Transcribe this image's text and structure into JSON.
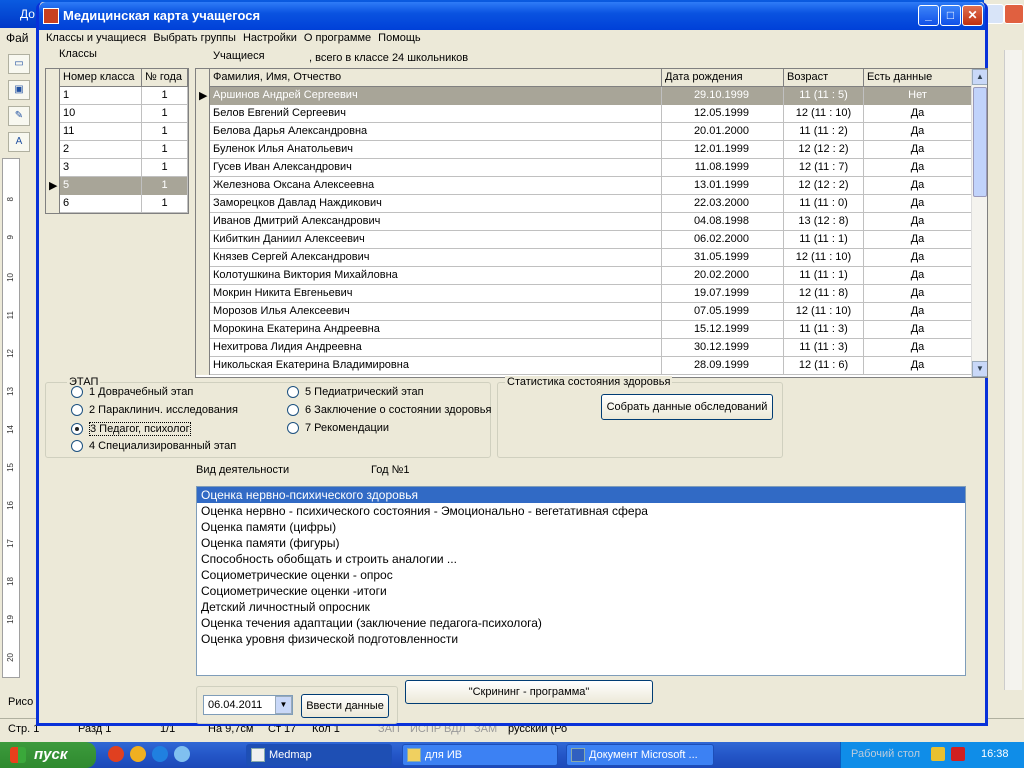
{
  "bg": {
    "title": "До",
    "menu": "Фай",
    "draw": "Рисо",
    "status": {
      "page": "Стр. 1",
      "section": "Разд 1",
      "pages": "1/1",
      "at": "На 9,7см",
      "line": "Ст 17",
      "col": "Кол 1",
      "rec": "ЗАП",
      "trk": "ИСПР",
      "ext": "ВДЛ",
      "ovr": "ЗАМ",
      "lang": "русский (Ро"
    },
    "ruler": [
      "8",
      "9",
      "10",
      "11",
      "12",
      "13",
      "14",
      "15",
      "16",
      "17",
      "18",
      "19",
      "20"
    ]
  },
  "window": {
    "title": "Медицинская карта учащегося",
    "menu": [
      "Классы и учащиеся",
      "Выбрать группы",
      "Настройки",
      "О программе",
      "Помощь"
    ]
  },
  "classes": {
    "label": "Классы",
    "headers": [
      "Номер класса",
      "№ года"
    ],
    "rows": [
      [
        "1",
        "1"
      ],
      [
        "10",
        "1"
      ],
      [
        "11",
        "1"
      ],
      [
        "2",
        "1"
      ],
      [
        "3",
        "1"
      ],
      [
        "5",
        "1"
      ],
      [
        "6",
        "1"
      ]
    ],
    "selected": 5
  },
  "students": {
    "label": "Учащиеся",
    "count_text": ", всего в классе 24 школьников",
    "headers": [
      "Фамилия, Имя, Отчество",
      "Дата рождения",
      "Возраст",
      "Есть данные"
    ],
    "rows": [
      [
        "Аршинов Андрей Сергеевич",
        "29.10.1999",
        "11 (11 : 5)",
        "Нет"
      ],
      [
        "Белов Евгений Сергеевич",
        "12.05.1999",
        "12 (11 : 10)",
        "Да"
      ],
      [
        "Белова Дарья Александровна",
        "20.01.2000",
        "11 (11 : 2)",
        "Да"
      ],
      [
        "Буленок Илья  Анатольевич",
        "12.01.1999",
        "12 (12 : 2)",
        "Да"
      ],
      [
        "Гусев Иван Александрович",
        "11.08.1999",
        "12 (11 : 7)",
        "Да"
      ],
      [
        "Железнова Оксана Алексеевна",
        "13.01.1999",
        "12 (12 : 2)",
        "Да"
      ],
      [
        "Заморецков Давлад Наждикович",
        "22.03.2000",
        "11 (11 : 0)",
        "Да"
      ],
      [
        "Иванов Дмитрий Александрович",
        "04.08.1998",
        "13 (12 : 8)",
        "Да"
      ],
      [
        "Кибиткин Даниил Алексеевич",
        "06.02.2000",
        "11 (11 : 1)",
        "Да"
      ],
      [
        "Князев Сергей Александрович",
        "31.05.1999",
        "12 (11 : 10)",
        "Да"
      ],
      [
        "Колотушкина Виктория Михайловна",
        "20.02.2000",
        "11 (11 : 1)",
        "Да"
      ],
      [
        "Мокрин Никита Евгеньевич",
        "19.07.1999",
        "12 (11 : 8)",
        "Да"
      ],
      [
        "Морозов Илья Алексеевич",
        "07.05.1999",
        "12 (11 : 10)",
        "Да"
      ],
      [
        "Морокина Екатерина Андреевна",
        "15.12.1999",
        "11 (11 : 3)",
        "Да"
      ],
      [
        "Нехитрова Лидия Андреевна",
        "30.12.1999",
        "11 (11 : 3)",
        "Да"
      ],
      [
        "Никольская Екатерина Владимировна",
        "28.09.1999",
        "12 (11 : 6)",
        "Да"
      ]
    ],
    "selected": 0
  },
  "stage": {
    "label": "ЭТАП",
    "options": [
      "1 Доврачебный этап",
      "2 Параклинич. исследования",
      "3 Педагог, психолог",
      "4 Специализированный этап",
      "5 Педиатрический этап",
      "6 Заключение о состоянии здоровья",
      "7 Рекомендации"
    ],
    "selected": 2
  },
  "stats": {
    "label": "Статистика состояния здоровья",
    "button": "Собрать данные обследований"
  },
  "activity": {
    "label": "Вид деятельности",
    "year": "Год №1",
    "items": [
      "Оценка нервно-психического здоровья",
      "Оценка нервно - психического состояния - Эмоционально - вегетативная сфера",
      "Оценка памяти (цифры)",
      "Оценка памяти (фигуры)",
      "Способность обобщать и строить аналогии ...",
      "Социометрические оценки - опрос",
      "Социометрические оценки -итоги",
      "Детский личностный опросник",
      "Оценка течения адаптации (заключение педагога-психолога)",
      "Оценка уровня физической подготовленности"
    ],
    "selected": 0
  },
  "bottom": {
    "date": "06.04.2011",
    "enter_button": "Ввести данные",
    "screening_button": "\"Скрининг - программа\""
  },
  "taskbar": {
    "start": "пуск",
    "items": [
      "Medmap",
      "для ИВ",
      "Документ Microsoft ..."
    ],
    "tray_text": "Рабочий стол",
    "clock": "16:38"
  }
}
